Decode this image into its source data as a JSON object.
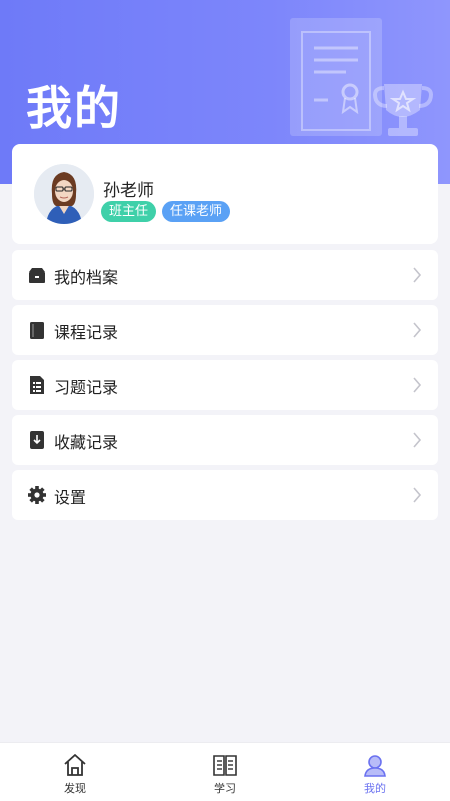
{
  "page": {
    "title": "我的"
  },
  "profile": {
    "name": "孙老师",
    "badges": [
      "班主任",
      "任课老师"
    ]
  },
  "menu": [
    {
      "label": "我的档案",
      "icon": "archive-box-icon"
    },
    {
      "label": "课程记录",
      "icon": "book-icon"
    },
    {
      "label": "习题记录",
      "icon": "document-list-icon"
    },
    {
      "label": "收藏记录",
      "icon": "bookmark-download-icon"
    },
    {
      "label": "设置",
      "icon": "gear-icon"
    }
  ],
  "tabs": [
    {
      "label": "发现",
      "icon": "home-icon",
      "active": false
    },
    {
      "label": "学习",
      "icon": "open-book-icon",
      "active": false
    },
    {
      "label": "我的",
      "icon": "user-icon",
      "active": true
    }
  ],
  "colors": {
    "header": "#7a84fa",
    "badge_head": "#3fd0a9",
    "badge_teacher": "#5aa1f5",
    "active_tab": "#6b72f0"
  }
}
